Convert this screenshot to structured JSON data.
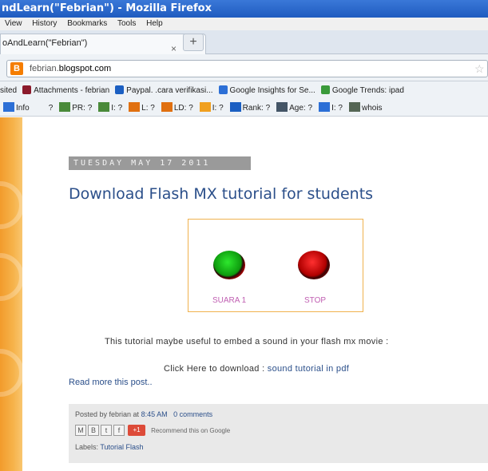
{
  "window": {
    "title": "ndLearn(\"Febrian\") - Mozilla Firefox"
  },
  "menu": {
    "items": [
      "View",
      "History",
      "Bookmarks",
      "Tools",
      "Help"
    ]
  },
  "tab": {
    "label": "oAndLearn(\"Febrian\")",
    "close": "×",
    "new": "+"
  },
  "urlbar": {
    "prefix": "febrian.",
    "domain": "blogspot.com",
    "icon": "B"
  },
  "bookmarks": [
    {
      "label": "sited",
      "color": "#ffffff",
      "icon": "none"
    },
    {
      "label": "Attachments - febrian",
      "color": "#8b1a2b",
      "icon": "bookmark-icon"
    },
    {
      "label": "Paypal. .cara verifikasi...",
      "color": "#1b5fc2",
      "icon": "paypal-icon"
    },
    {
      "label": "Google Insights for Se...",
      "color": "#2c6fd6",
      "icon": "insights-icon"
    },
    {
      "label": "Google Trends: ipad",
      "color": "#3a9a3a",
      "icon": "trends-icon"
    }
  ],
  "seo_toolbar": [
    {
      "label": "Info",
      "color": "#2c6fd6"
    },
    {
      "label": "?",
      "color": "#eef2f6"
    },
    {
      "label": "PR: ?",
      "color": "#4a8a3a"
    },
    {
      "label": "I: ?",
      "color": "#4a8a3a"
    },
    {
      "label": "L: ?",
      "color": "#e07010"
    },
    {
      "label": "LD: ?",
      "color": "#e07010"
    },
    {
      "label": "I: ?",
      "color": "#f0a020"
    },
    {
      "label": "Rank: ?",
      "color": "#1b5fc2"
    },
    {
      "label": "Age: ?",
      "color": "#445566"
    },
    {
      "label": "I: ?",
      "color": "#2c6fd6"
    },
    {
      "label": "whois",
      "color": "#556655"
    }
  ],
  "post": {
    "date": "TUESDAY MAY 17 2011",
    "title": "Download Flash MX tutorial for students",
    "flash": {
      "button1_label": "SUARA 1",
      "button2_label": "STOP"
    },
    "body": "This tutorial maybe useful to embed a sound in your flash mx movie :",
    "download_prefix": "Click Here to download :",
    "download_link": "sound tutorial in pdf",
    "read_more": "Read more this post..",
    "posted_prefix": "Posted by febrian at",
    "posted_time": "8:45 AM",
    "comments": "0 comments",
    "gplus": "+1",
    "recommend": "Recommend this on Google",
    "labels_prefix": "Labels:",
    "labels_value": "Tutorial Flash"
  }
}
